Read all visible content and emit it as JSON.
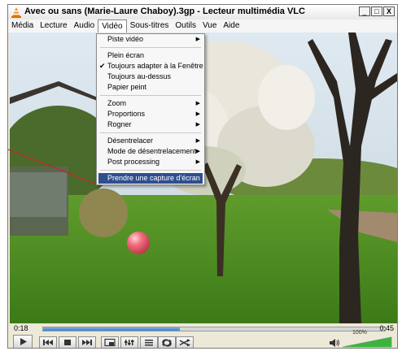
{
  "window": {
    "title": "Avec ou sans (Marie-Laure Chaboy).3gp - Lecteur multimédia VLC",
    "buttons": {
      "minimize": "_",
      "maximize": "□",
      "close": "X"
    }
  },
  "menubar": {
    "items": [
      "Média",
      "Lecture",
      "Audio",
      "Vidéo",
      "Sous-titres",
      "Outils",
      "Vue",
      "Aide"
    ],
    "active": "Vidéo"
  },
  "video_menu": {
    "items": [
      {
        "label": "Piste vidéo",
        "submenu": true
      },
      {
        "label": "Plein écran"
      },
      {
        "label": "Toujours adapter à la Fenêtre",
        "checked": true
      },
      {
        "label": "Toujours au-dessus"
      },
      {
        "label": "Papier peint"
      },
      {
        "label": "Zoom",
        "submenu": true
      },
      {
        "label": "Proportions",
        "submenu": true
      },
      {
        "label": "Rogner",
        "submenu": true
      },
      {
        "label": "Désentrelacer",
        "submenu": true
      },
      {
        "label": "Mode de désentrelacement",
        "submenu": true
      },
      {
        "label": "Post processing",
        "submenu": true
      },
      {
        "label": "Prendre une capture d'écran",
        "highlighted": true
      }
    ]
  },
  "playback": {
    "elapsed": "0:18",
    "total": "0:45",
    "progress": 0.4,
    "volume": "100%",
    "volume_level": 1.0
  },
  "icons": {
    "play": "play-icon",
    "previous": "previous-icon",
    "stop": "stop-icon",
    "next": "next-icon",
    "fullscreen": "fullscreen-icon",
    "equalizer": "equalizer-icon",
    "playlist": "playlist-icon",
    "loop": "loop-icon",
    "shuffle": "shuffle-icon",
    "speaker": "speaker-icon"
  },
  "colors": {
    "menu_highlight": "#2e4f8f",
    "seek_fill": "#3f7fc9",
    "volume_fill": "#3cb43c",
    "annotation_arrow": "#d32020"
  }
}
